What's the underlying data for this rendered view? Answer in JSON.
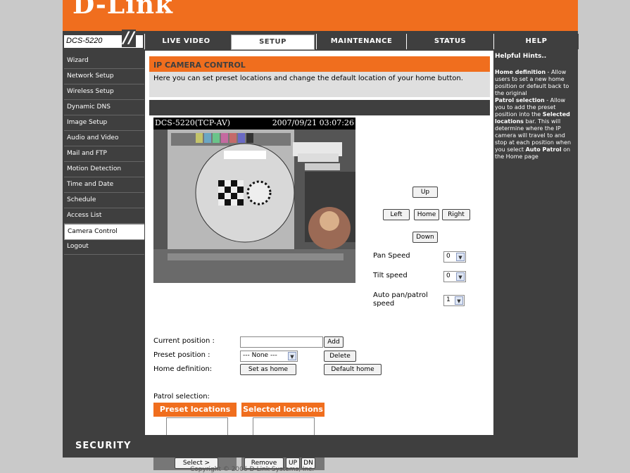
{
  "brand": {
    "logo": "D-Link",
    "model": "DCS-5220"
  },
  "nav": {
    "tabs": [
      {
        "label": "LIVE VIDEO",
        "active": false
      },
      {
        "label": "SETUP",
        "active": true
      },
      {
        "label": "MAINTENANCE",
        "active": false
      },
      {
        "label": "STATUS",
        "active": false
      },
      {
        "label": "HELP",
        "active": false
      }
    ]
  },
  "sidebar": {
    "items": [
      {
        "label": "Wizard"
      },
      {
        "label": "Network Setup"
      },
      {
        "label": "Wireless Setup"
      },
      {
        "label": "Dynamic DNS"
      },
      {
        "label": "Image Setup"
      },
      {
        "label": "Audio and Video"
      },
      {
        "label": "Mail and FTP"
      },
      {
        "label": "Motion Detection"
      },
      {
        "label": "Time and Date"
      },
      {
        "label": "Schedule"
      },
      {
        "label": "Access List"
      },
      {
        "label": "Camera Control",
        "active": true
      },
      {
        "label": "Logout"
      }
    ]
  },
  "section": {
    "title": "IP CAMERA CONTROL",
    "description": "Here you can set preset locations and change the default location of your home button."
  },
  "camera": {
    "name": "DCS-5220(TCP-AV)",
    "timestamp": "2007/09/21 03:07:26"
  },
  "ptz": {
    "up": "Up",
    "left": "Left",
    "home": "Home",
    "right": "Right",
    "down": "Down"
  },
  "speeds": {
    "pan_label": "Pan Speed",
    "pan_value": "0",
    "tilt_label": "Tilt speed",
    "tilt_value": "0",
    "auto_label_1": "Auto pan/patrol",
    "auto_label_2": "speed",
    "auto_value": "1"
  },
  "preset_form": {
    "current_position_label": "Current position :",
    "add_button": "Add",
    "preset_position_label": "Preset position :",
    "preset_position_value": "--- None ---",
    "delete_button": "Delete",
    "home_definition_label": "Home definition:",
    "set_as_home_button": "Set as home",
    "default_home_button": "Default home"
  },
  "patrol": {
    "label": "Patrol selection:",
    "preset_locations_header": "Preset locations",
    "selected_locations_header": "Selected locations",
    "select_button": "Select >",
    "remove_button": "Remove",
    "up_button": "UP",
    "dn_button": "DN"
  },
  "help": {
    "title": "Helpful Hints..",
    "home_term": "Home definition",
    "home_text": " - Allow users to set a new home position or default back to the original",
    "patrol_term": "Patrol selection",
    "patrol_text_1": " - Allow you to add the preset position into the ",
    "patrol_bold_1": "Selected locations",
    "patrol_text_2": " bar. This will determine where the IP camera will travel to and stop at each position when you select ",
    "patrol_bold_2": "Auto Patrol",
    "patrol_text_3": " on the Home page"
  },
  "footer": {
    "security": "SECURITY",
    "copyright": "Copyright © 2006 D-Link Systems, Inc."
  },
  "colors": {
    "accent": "#f06e1e",
    "dark": "#3f3f3f"
  }
}
